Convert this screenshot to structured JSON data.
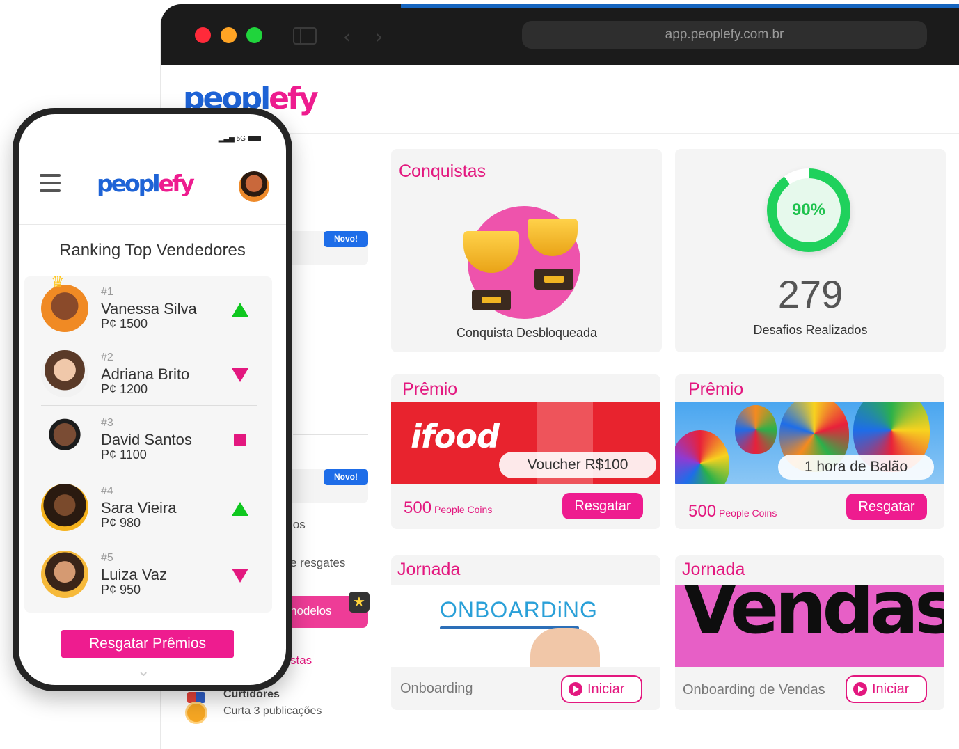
{
  "browser": {
    "url": "app.peoplefy.com.br"
  },
  "app": {
    "logo": {
      "part1": "peopl",
      "part2": "efy"
    }
  },
  "sidebar": {
    "badges": [
      "Novo!",
      "Novo!"
    ],
    "fragments": [
      "ios",
      "e resgates",
      "nodelos",
      "stas"
    ],
    "achievement": {
      "title": "Curtidores",
      "subtitle": "Curta 3 publicações"
    }
  },
  "cards": {
    "conquistas": {
      "title": "Conquistas",
      "caption": "Conquista Desbloqueada"
    },
    "desafios": {
      "percent": "90%",
      "percent_value": 0.9,
      "count": "279",
      "caption": "Desafios Realizados"
    },
    "premio1": {
      "title": "Prêmio",
      "brand": "ifood",
      "voucher": "Voucher R$100",
      "coins": "500",
      "coins_label": "People Coins",
      "button": "Resgatar"
    },
    "premio2": {
      "title": "Prêmio",
      "voucher": "1 hora de Balão",
      "coins": "500",
      "coins_label": "People Coins",
      "button": "Resgatar"
    },
    "jornada1": {
      "title": "Jornada",
      "banner": "ONBOARDiNG",
      "caption": "Onboarding",
      "button": "Iniciar"
    },
    "jornada2": {
      "title": "Jornada",
      "banner": "Vendas",
      "caption": "Onboarding de Vendas",
      "button": "Iniciar"
    }
  },
  "phone": {
    "status": "5G",
    "title": "Ranking Top Vendedores",
    "ranking": [
      {
        "pos": "#1",
        "name": "Vanessa Silva",
        "points": "P¢ 1500",
        "trend": "up"
      },
      {
        "pos": "#2",
        "name": "Adriana Brito",
        "points": "P¢ 1200",
        "trend": "down"
      },
      {
        "pos": "#3",
        "name": "David Santos",
        "points": "P¢ 1100",
        "trend": "same"
      },
      {
        "pos": "#4",
        "name": "Sara Vieira",
        "points": "P¢ 980",
        "trend": "up"
      },
      {
        "pos": "#5",
        "name": "Luiza Vaz",
        "points": "P¢ 950",
        "trend": "down"
      }
    ],
    "cta": "Resgatar Prêmios"
  },
  "colors": {
    "brand_blue": "#1e63d6",
    "brand_pink": "#ee1c8f",
    "up": "#0fc71f"
  },
  "icons": [
    "hamburger-icon",
    "play-icon",
    "star-icon",
    "chevron-down-icon",
    "trophy-icon",
    "medal-icon"
  ]
}
